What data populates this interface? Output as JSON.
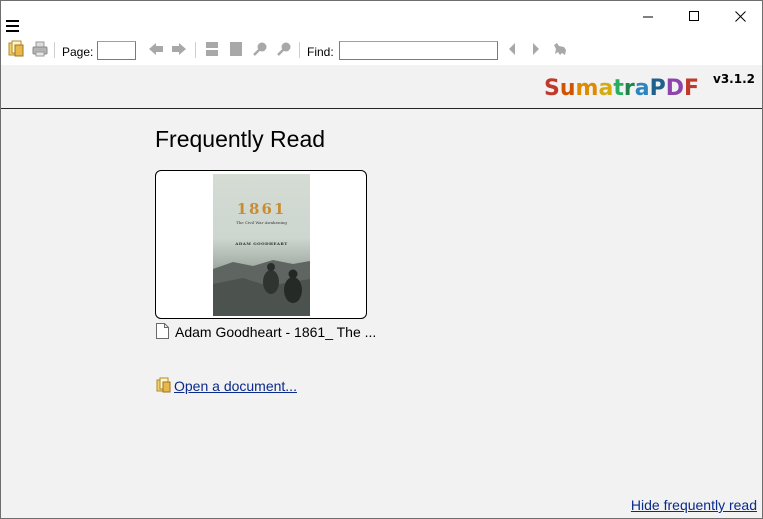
{
  "toolbar": {
    "page_label": "Page:",
    "page_value": "",
    "find_label": "Find:",
    "find_value": ""
  },
  "banner": {
    "logo_letters": [
      "S",
      "u",
      "m",
      "a",
      "t",
      "r",
      "a",
      "P",
      "D",
      "F"
    ],
    "logo_colors": [
      "#c0392b",
      "#d35400",
      "#e08a00",
      "#d4ac0d",
      "#27ae60",
      "#1e8449",
      "#2e86c1",
      "#1f618d",
      "#8e44ad",
      "#c0392b"
    ],
    "version": "v3.1.2"
  },
  "main": {
    "heading": "Frequently Read",
    "recent": [
      {
        "file_label": "Adam Goodheart - 1861_ The ...",
        "cover_title": "1861",
        "cover_subtitle": "The Civil War Awakening",
        "cover_author": "ADAM GOODHEART"
      }
    ],
    "open_document": "Open a document...",
    "hide_frequently_read": "Hide frequently read"
  },
  "colors": {
    "background": "#f2f2f2",
    "link": "#0a2a8c",
    "banner_rule": "#262626"
  }
}
